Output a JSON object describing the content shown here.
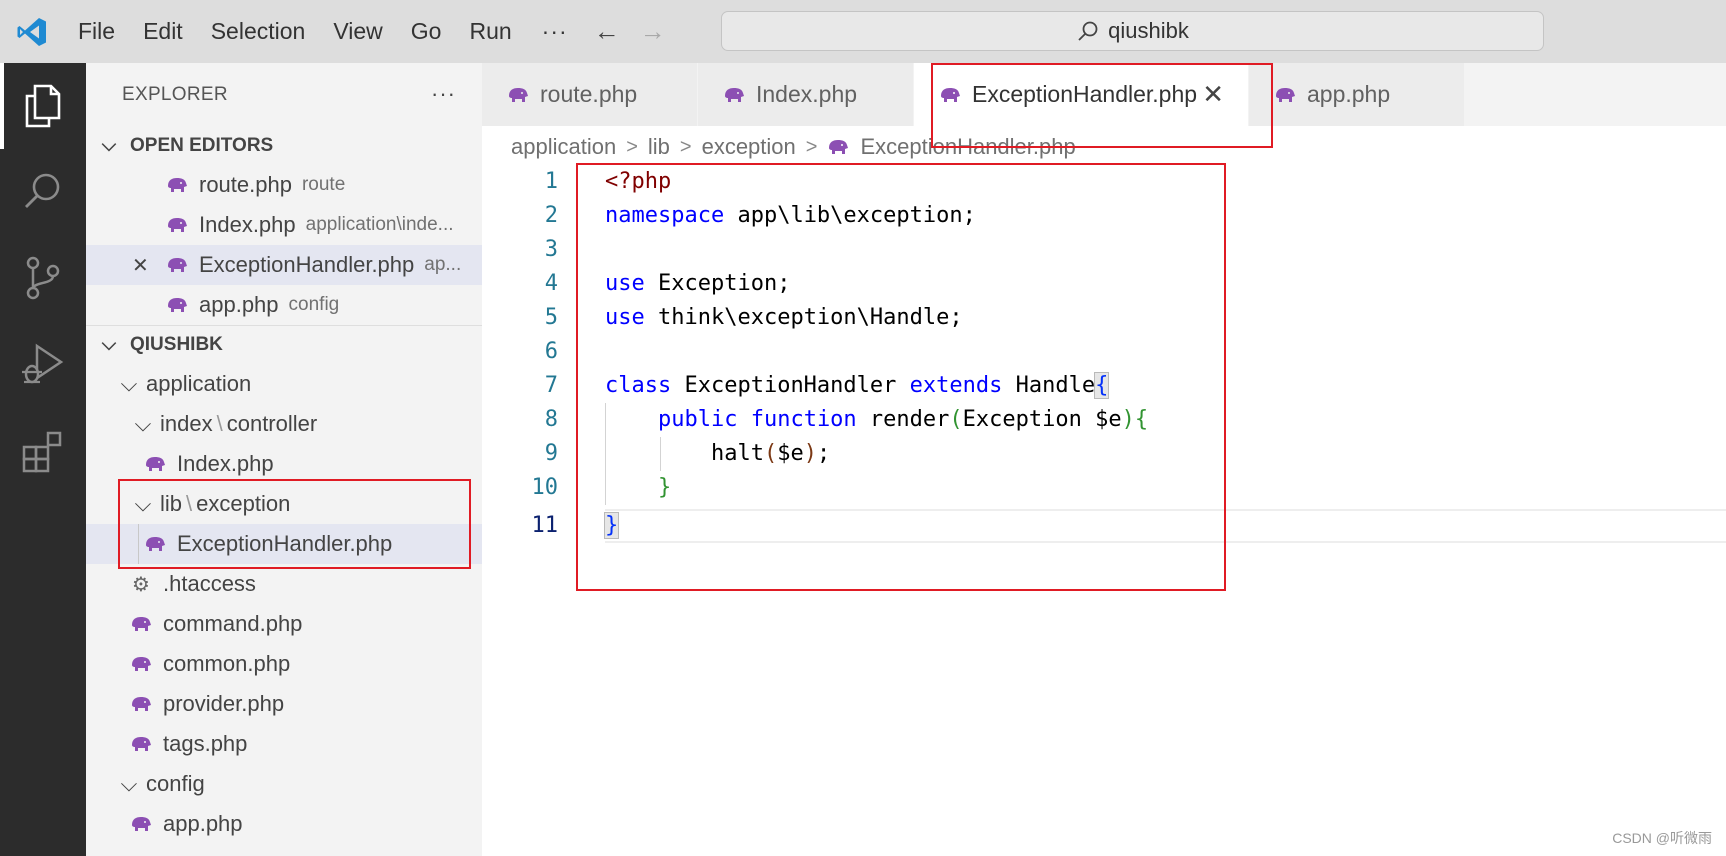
{
  "menu": {
    "items": [
      "File",
      "Edit",
      "Selection",
      "View",
      "Go",
      "Run"
    ],
    "more": "···"
  },
  "search": {
    "text": "qiushibk"
  },
  "sidebar": {
    "title": "EXPLORER",
    "dots": "···",
    "open_editors": {
      "label": "OPEN EDITORS",
      "items": [
        {
          "name": "route.php",
          "desc": "route"
        },
        {
          "name": "Index.php",
          "desc": "application\\inde..."
        },
        {
          "name": "ExceptionHandler.php",
          "desc": "ap..."
        },
        {
          "name": "app.php",
          "desc": "config"
        }
      ]
    },
    "project": {
      "label": "QIUSHIBK",
      "application": "application",
      "index_a": "index",
      "index_b": "controller",
      "index_file": "Index.php",
      "lib_a": "lib",
      "lib_b": "exception",
      "lib_file": "ExceptionHandler.php",
      "htaccess": ".htaccess",
      "command": "command.php",
      "common": "common.php",
      "provider": "provider.php",
      "tags": "tags.php",
      "config": "config",
      "config_app": "app.php"
    }
  },
  "tabs": [
    {
      "label": "route.php"
    },
    {
      "label": "Index.php"
    },
    {
      "label": "ExceptionHandler.php"
    },
    {
      "label": "app.php"
    }
  ],
  "breadcrumb": [
    "application",
    "lib",
    "exception",
    "ExceptionHandler.php"
  ],
  "editor": {
    "line_numbers": [
      "1",
      "2",
      "3",
      "4",
      "5",
      "6",
      "7",
      "8",
      "9",
      "10",
      "11"
    ],
    "line1_tag": "<?php",
    "line2_kw": "namespace",
    "line2_rest": " app\\lib\\exception;",
    "line4_kw": "use",
    "line4_rest": " Exception;",
    "line5_kw": "use",
    "line5_rest": " think\\exception\\Handle;",
    "line7_kw1": "class",
    "line7_name": " ExceptionHandler ",
    "line7_kw2": "extends",
    "line7_parent": " Handle",
    "line7_brace": "{",
    "line8_indent": "    ",
    "line8_kw1": "public",
    "line8_kw2": " function",
    "line8_fn": " render",
    "line8_open": "(",
    "line8_args": "Exception $e",
    "line8_close": ")",
    "line8_brace": "{",
    "line9_indent": "        ",
    "line9_fn": "halt",
    "line9_open": "(",
    "line9_arg": "$e",
    "line9_close": ")",
    "line9_semi": ";",
    "line10_indent": "    ",
    "line10_brace": "}",
    "line11_brace": "}"
  },
  "watermark": "CSDN @听微雨",
  "colors": {
    "keyword": "#0000ff",
    "php_tag": "#800000",
    "line_number": "#237893",
    "highlight_box": "#e01b24",
    "php_icon": "#8c4fb3"
  }
}
